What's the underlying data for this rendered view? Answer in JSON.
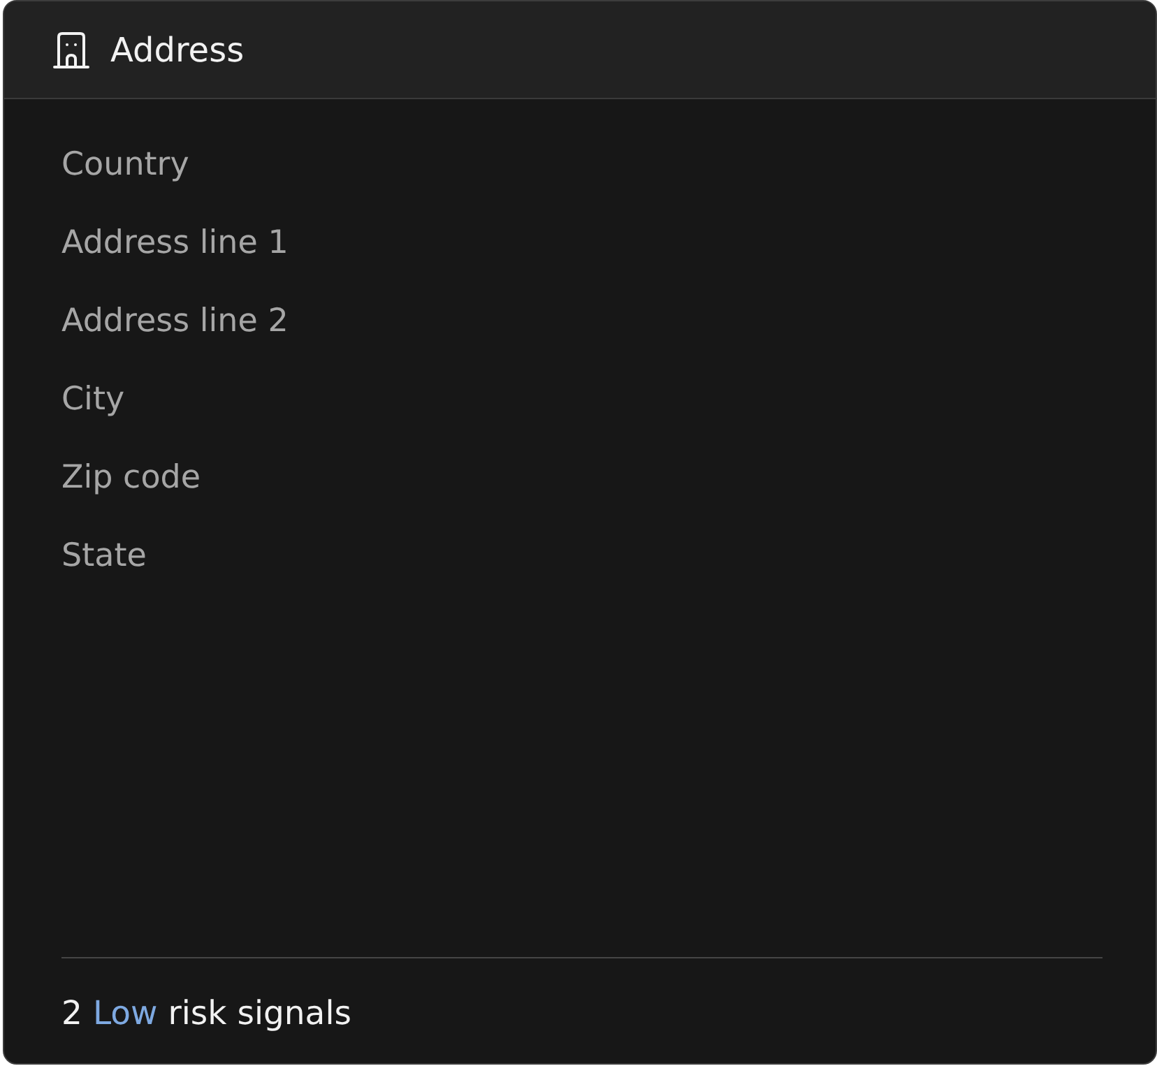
{
  "card": {
    "title": "Address"
  },
  "fields": [
    {
      "label": "Country"
    },
    {
      "label": "Address line 1"
    },
    {
      "label": "Address line 2"
    },
    {
      "label": "City"
    },
    {
      "label": "Zip code"
    },
    {
      "label": "State"
    }
  ],
  "risk_summary": {
    "count": "2",
    "level": "Low",
    "text": "risk signals"
  }
}
